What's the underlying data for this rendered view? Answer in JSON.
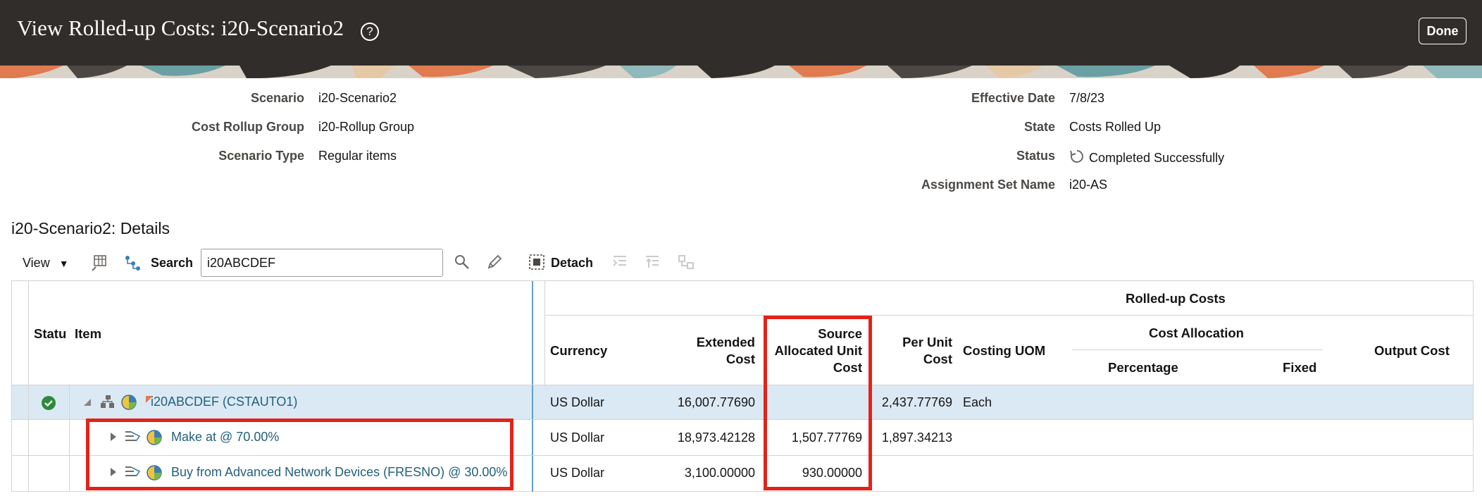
{
  "header": {
    "title": "View Rolled-up Costs: i20-Scenario2",
    "help_glyph": "?",
    "done_label": "Done"
  },
  "info": {
    "left": [
      {
        "label": "Scenario",
        "value": "i20-Scenario2"
      },
      {
        "label": "Cost Rollup Group",
        "value": "i20-Rollup Group"
      },
      {
        "label": "Scenario Type",
        "value": "Regular items"
      }
    ],
    "right": [
      {
        "label": "Effective Date",
        "value": "7/8/23"
      },
      {
        "label": "State",
        "value": "Costs Rolled Up"
      },
      {
        "label": "Status",
        "value": "Completed Successfully"
      },
      {
        "label": "Assignment Set Name",
        "value": "i20-AS"
      }
    ]
  },
  "details": {
    "title": "i20-Scenario2: Details"
  },
  "toolbar": {
    "view_label": "View",
    "search_label": "Search",
    "search_value": "i20ABCDEF",
    "detach_label": "Detach"
  },
  "table": {
    "group_header": "Rolled-up Costs",
    "cost_allocation_header": "Cost Allocation",
    "columns": {
      "status": "Statu",
      "item": "Item",
      "currency": "Currency",
      "extended_cost_1": "Extended",
      "extended_cost_2": "Cost",
      "source_alloc_1": "Source",
      "source_alloc_2": "Allocated Unit",
      "source_alloc_3": "Cost",
      "per_unit_1": "Per Unit",
      "per_unit_2": "Cost",
      "costing_uom": "Costing UOM",
      "percentage": "Percentage",
      "fixed": "Fixed",
      "output_cost": "Output Cost"
    },
    "rows": [
      {
        "item": "i20ABCDEF (CSTAUTO1)",
        "currency": "US Dollar",
        "extended_cost": "16,007.77690",
        "source_allocated_unit_cost": "",
        "per_unit_cost": "2,437.77769",
        "costing_uom": "Each"
      },
      {
        "item": "Make at @ 70.00%",
        "currency": "US Dollar",
        "extended_cost": "18,973.42128",
        "source_allocated_unit_cost": "1,507.77769",
        "per_unit_cost": "1,897.34213",
        "costing_uom": ""
      },
      {
        "item": "Buy from Advanced Network Devices (FRESNO) @ 30.00%",
        "currency": "US Dollar",
        "extended_cost": "3,100.00000",
        "source_allocated_unit_cost": "930.00000",
        "per_unit_cost": "",
        "costing_uom": ""
      }
    ]
  },
  "colors": {
    "header_bg": "#312d2a",
    "link": "#22607d",
    "highlight_row": "#dbe9f4",
    "annotation_red": "#e2231a",
    "success_green": "#2c8a3b"
  }
}
